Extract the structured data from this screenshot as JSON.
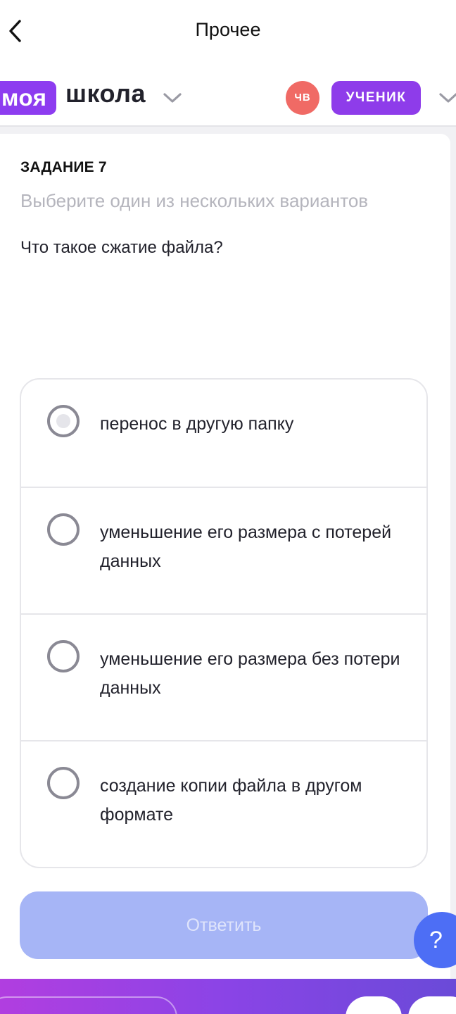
{
  "header": {
    "title": "Прочее",
    "back_icon": "chevron-left-icon"
  },
  "brand": {
    "logo_part1": "моя",
    "logo_part2": "школа",
    "school_dropdown_icon": "chevron-down-icon",
    "avatar_initials": "ЧВ",
    "role_label": "УЧЕНИК",
    "role_dropdown_icon": "chevron-down-icon",
    "colors": {
      "brand_purple": "#8d3cf0",
      "avatar_red": "#f06a65"
    }
  },
  "task": {
    "number_label": "ЗАДАНИЕ 7",
    "hint": "Выберите один из нескольких вариантов",
    "question": "Что такое сжатие файла?",
    "options": [
      {
        "label": "перенос в другую папку",
        "selected": false
      },
      {
        "label": "уменьшение его размера с потерей данных",
        "selected": false
      },
      {
        "label": "уменьшение его размера без потери данных",
        "selected": false
      },
      {
        "label": "создание копии файла в другом формате",
        "selected": false
      }
    ],
    "submit_label": "Ответить",
    "submit_enabled": false
  },
  "help": {
    "label": "?",
    "color": "#4d6ef5"
  }
}
